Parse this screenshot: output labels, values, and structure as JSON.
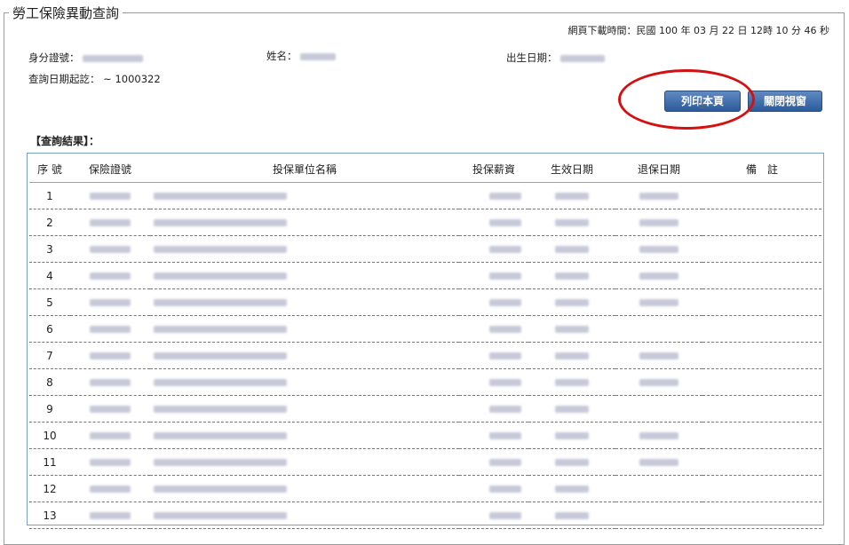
{
  "page": {
    "legend": "勞工保險異動查詢",
    "download_time": "網頁下載時間：民國 100 年 03 月 22 日 12時 10 分 46 秒"
  },
  "info": {
    "id_label": "身分證號：",
    "name_label": "姓名：",
    "birth_label": "出生日期：",
    "date_range_label": "查詢日期起訖：",
    "date_range_value": "~ 1000322"
  },
  "buttons": {
    "print": "列印本頁",
    "close": "關閉視窗"
  },
  "result_label": "【查詢結果】：",
  "table": {
    "headers": [
      "序 號",
      "保險證號",
      "投保單位名稱",
      "投保薪資",
      "生效日期",
      "退保日期",
      "備　註"
    ],
    "rows": [
      {
        "seq": "1",
        "cols": [
          1,
          1,
          1,
          1,
          1
        ]
      },
      {
        "seq": "2",
        "cols": [
          1,
          1,
          1,
          1,
          1
        ]
      },
      {
        "seq": "3",
        "cols": [
          1,
          1,
          1,
          1,
          1
        ]
      },
      {
        "seq": "4",
        "cols": [
          1,
          1,
          1,
          1,
          1
        ]
      },
      {
        "seq": "5",
        "cols": [
          1,
          1,
          1,
          1,
          1
        ]
      },
      {
        "seq": "6",
        "cols": [
          1,
          1,
          1,
          1,
          0
        ]
      },
      {
        "seq": "7",
        "cols": [
          1,
          1,
          1,
          1,
          1
        ]
      },
      {
        "seq": "8",
        "cols": [
          1,
          1,
          1,
          1,
          1
        ]
      },
      {
        "seq": "9",
        "cols": [
          1,
          1,
          1,
          1,
          0
        ]
      },
      {
        "seq": "10",
        "cols": [
          1,
          1,
          1,
          1,
          1
        ]
      },
      {
        "seq": "11",
        "cols": [
          1,
          1,
          1,
          1,
          1
        ]
      },
      {
        "seq": "12",
        "cols": [
          1,
          1,
          1,
          1,
          0
        ]
      },
      {
        "seq": "13",
        "cols": [
          1,
          1,
          1,
          1,
          0
        ]
      }
    ]
  },
  "colors": {
    "button": "#2c5a9a",
    "highlight": "#d41010",
    "table_border": "#7aa0c8"
  }
}
